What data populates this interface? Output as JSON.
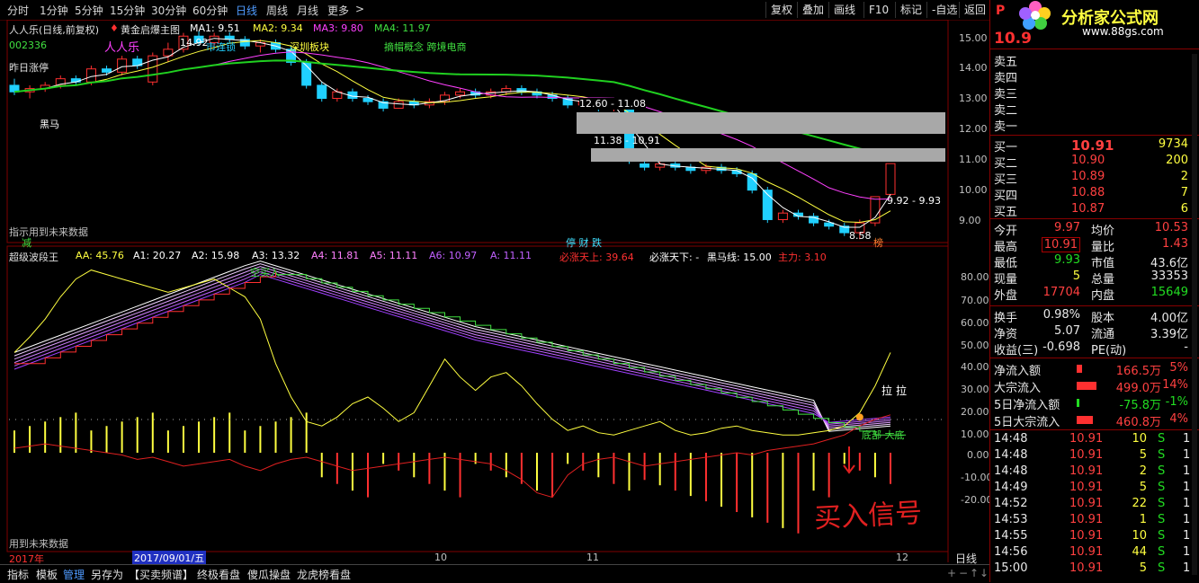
{
  "toolbar": {
    "periods": [
      "分时",
      "1分钟",
      "5分钟",
      "15分钟",
      "30分钟",
      "60分钟",
      "日线",
      "周线",
      "月线",
      "更多"
    ],
    "active_period": "日线",
    "more_arrow": ">",
    "buttons": [
      "复权",
      "叠加",
      "画线",
      "F10",
      "标记",
      "-自选",
      "返回"
    ]
  },
  "main_chart": {
    "title_stock": "人人乐(日线,前复权)",
    "title_indicator": "黄金启爆主图",
    "ma1": "MA1: 9.51",
    "ma2": "MA2: 9.34",
    "ma3": "MA3: 9.80",
    "ma4": "MA4: 11.97",
    "code": "002336",
    "name_overlay": "人人乐",
    "price_top_label": "14.92",
    "tag_lianbang": "市连锁",
    "tag_shenzhen": "深圳板块",
    "tag_concept": "摘帽概念 跨境电商",
    "yesterday_limit": "昨日涨停",
    "black_horse": "黑马",
    "range1": "12.60 - 11.08",
    "range2": "11.38 - 10.91",
    "range3": "9.92 - 9.93",
    "low_label": "8.58",
    "note_future": "指示用到未来数据",
    "tag_jian": "减",
    "tag_mid": "停 财 跌",
    "tag_bang": "榜",
    "price_axis": [
      "15.00",
      "14.00",
      "13.00",
      "12.00",
      "11.00",
      "10.00",
      "9.00"
    ],
    "colors": {
      "up": "#ff3030",
      "down": "#20d0ff",
      "ma1": "#ffffff",
      "ma2": "#ffff40",
      "ma3": "#ff40ff",
      "ma4": "#20d020"
    }
  },
  "sub_chart": {
    "name": "超级波段王",
    "aa": "AA: 45.76",
    "a1": "A1: 20.27",
    "a2": "A2: 15.98",
    "a3": "A3: 13.32",
    "a4": "A4: 11.81",
    "a5": "A5: 11.11",
    "a6": "A6: 10.97",
    "a": "A: 11.11",
    "bizhang_up": "必涨天上: 39.64",
    "bizhang_down": "必涨天下: -",
    "heima_line": "黑马线: 15.00",
    "zhuli": "主力: 3.10",
    "tag_buyin": "空买入",
    "tag_la1": "拉",
    "tag_la2": "拉",
    "tag_bottom": "底部 大底",
    "handwriting": "买入信号",
    "note_future": "用到未来数据",
    "axis": [
      "80.00",
      "70.00",
      "60.00",
      "50.00",
      "40.00",
      "30.00",
      "20.00",
      "10.00",
      "0.00",
      "-10.00",
      "-20.00"
    ]
  },
  "xaxis": {
    "year": "2017年",
    "cursor_date": "2017/09/01/五",
    "months": [
      "10",
      "11",
      "12"
    ],
    "period_btn": "日线"
  },
  "bottombar": [
    "指标",
    "模板",
    "管理",
    "另存为",
    "【买卖频谱】",
    "终极看盘",
    "傻瓜操盘",
    "龙虎榜看盘"
  ],
  "panel": {
    "brand_p": "P",
    "brand_name": "分析家公式网",
    "brand_url": "www.88gs.com",
    "price": "10.9",
    "sell": [
      {
        "label": "卖五",
        "price": "",
        "vol": ""
      },
      {
        "label": "卖四",
        "price": "",
        "vol": ""
      },
      {
        "label": "卖三",
        "price": "",
        "vol": ""
      },
      {
        "label": "卖二",
        "price": "",
        "vol": ""
      },
      {
        "label": "卖一",
        "price": "",
        "vol": ""
      }
    ],
    "buy": [
      {
        "label": "买一",
        "price": "10.91",
        "vol": "9734"
      },
      {
        "label": "买二",
        "price": "10.90",
        "vol": "200"
      },
      {
        "label": "买三",
        "price": "10.89",
        "vol": "2"
      },
      {
        "label": "买四",
        "price": "10.88",
        "vol": "7"
      },
      {
        "label": "买五",
        "price": "10.87",
        "vol": "6"
      }
    ],
    "stats": [
      {
        "l1": "今开",
        "v1": "9.97",
        "l2": "均价",
        "v2": "10.53"
      },
      {
        "l1": "最高",
        "v1": "10.91",
        "l2": "量比",
        "v2": "1.43"
      },
      {
        "l1": "最低",
        "v1": "9.93",
        "l2": "市值",
        "v2": "43.6亿"
      },
      {
        "l1": "现量",
        "v1": "5",
        "l2": "总量",
        "v2": "33353"
      },
      {
        "l1": "外盘",
        "v1": "17704",
        "l2": "内盘",
        "v2": "15649"
      }
    ],
    "finance": [
      {
        "l1": "换手",
        "v1": "0.98%",
        "l2": "股本",
        "v2": "4.00亿"
      },
      {
        "l1": "净资",
        "v1": "5.07",
        "l2": "流通",
        "v2": "3.39亿"
      },
      {
        "l1": "收益(三)",
        "v1": "-0.698",
        "l2": "PE(动)",
        "v2": "-"
      }
    ],
    "flows": [
      {
        "label": "净流入额",
        "value": "166.5万",
        "pct": "5%",
        "color": "red"
      },
      {
        "label": "大宗流入",
        "value": "499.0万",
        "pct": "14%",
        "color": "red"
      },
      {
        "label": "5日净流入额",
        "value": "-75.8万",
        "pct": "-1%",
        "color": "green"
      },
      {
        "label": "5日大宗流入",
        "value": "460.8万",
        "pct": "4%",
        "color": "red"
      }
    ],
    "ticks": [
      {
        "time": "14:48",
        "price": "10.91",
        "vol": "10",
        "side": "S",
        "n": "1"
      },
      {
        "time": "14:48",
        "price": "10.91",
        "vol": "5",
        "side": "S",
        "n": "1"
      },
      {
        "time": "14:48",
        "price": "10.91",
        "vol": "2",
        "side": "S",
        "n": "1"
      },
      {
        "time": "14:49",
        "price": "10.91",
        "vol": "5",
        "side": "S",
        "n": "1"
      },
      {
        "time": "14:52",
        "price": "10.91",
        "vol": "22",
        "side": "S",
        "n": "1"
      },
      {
        "time": "14:53",
        "price": "10.91",
        "vol": "1",
        "side": "S",
        "n": "1"
      },
      {
        "time": "14:55",
        "price": "10.91",
        "vol": "10",
        "side": "S",
        "n": "1"
      },
      {
        "time": "14:56",
        "price": "10.91",
        "vol": "44",
        "side": "S",
        "n": "1"
      },
      {
        "time": "15:00",
        "price": "10.91",
        "vol": "5",
        "side": "S",
        "n": "1"
      }
    ]
  },
  "chart_data": {
    "type": "candlestick",
    "candles": [
      [
        13.3,
        13.5,
        13.0,
        13.1
      ],
      [
        13.1,
        13.3,
        12.9,
        13.2
      ],
      [
        13.2,
        13.4,
        13.1,
        13.3
      ],
      [
        13.3,
        13.6,
        13.2,
        13.5
      ],
      [
        13.5,
        13.6,
        13.3,
        13.4
      ],
      [
        13.4,
        13.9,
        13.3,
        13.8
      ],
      [
        13.8,
        13.9,
        13.6,
        13.7
      ],
      [
        13.7,
        14.2,
        13.6,
        14.1
      ],
      [
        14.1,
        14.2,
        13.8,
        13.9
      ],
      [
        13.4,
        14.3,
        13.3,
        14.2
      ],
      [
        14.2,
        14.6,
        14.0,
        14.4
      ],
      [
        14.4,
        14.9,
        14.3,
        14.8
      ],
      [
        14.8,
        14.95,
        14.5,
        14.6
      ],
      [
        14.6,
        14.9,
        14.5,
        14.8
      ],
      [
        14.8,
        14.92,
        14.6,
        14.7
      ],
      [
        14.7,
        14.8,
        14.4,
        14.5
      ],
      [
        14.5,
        14.7,
        14.3,
        14.6
      ],
      [
        14.6,
        14.7,
        14.3,
        14.4
      ],
      [
        14.4,
        14.5,
        13.9,
        14.0
      ],
      [
        14.0,
        14.1,
        13.2,
        13.3
      ],
      [
        13.3,
        13.4,
        12.8,
        12.9
      ],
      [
        12.9,
        13.2,
        12.8,
        13.1
      ],
      [
        13.1,
        13.2,
        12.8,
        12.9
      ],
      [
        12.9,
        13.0,
        12.7,
        12.8
      ],
      [
        12.8,
        12.9,
        12.5,
        12.6
      ],
      [
        12.6,
        12.9,
        12.6,
        12.8
      ],
      [
        12.8,
        12.9,
        12.6,
        12.7
      ],
      [
        12.7,
        12.9,
        12.6,
        12.8
      ],
      [
        12.8,
        13.1,
        12.7,
        13.0
      ],
      [
        13.0,
        13.2,
        12.9,
        13.1
      ],
      [
        13.1,
        13.2,
        12.9,
        13.0
      ],
      [
        13.0,
        13.2,
        12.9,
        13.1
      ],
      [
        13.1,
        13.3,
        13.0,
        13.2
      ],
      [
        13.2,
        13.3,
        13.0,
        13.1
      ],
      [
        13.1,
        13.2,
        12.9,
        13.0
      ],
      [
        13.0,
        13.1,
        12.8,
        12.9
      ],
      [
        12.9,
        13.0,
        12.6,
        12.7
      ],
      [
        12.7,
        12.9,
        12.6,
        12.8
      ],
      [
        12.8,
        12.9,
        12.5,
        12.6
      ],
      [
        12.6,
        12.8,
        12.5,
        12.7
      ],
      [
        12.7,
        12.8,
        10.9,
        11.0
      ],
      [
        10.9,
        11.1,
        10.7,
        10.8
      ],
      [
        10.8,
        11.0,
        10.7,
        10.9
      ],
      [
        10.9,
        11.0,
        10.7,
        10.8
      ],
      [
        10.8,
        10.9,
        10.6,
        10.7
      ],
      [
        10.7,
        10.9,
        10.6,
        10.8
      ],
      [
        10.8,
        10.9,
        10.6,
        10.7
      ],
      [
        10.7,
        10.8,
        10.5,
        10.6
      ],
      [
        10.6,
        10.7,
        10.0,
        10.1
      ],
      [
        10.1,
        10.2,
        9.1,
        9.2
      ],
      [
        9.2,
        9.5,
        9.1,
        9.4
      ],
      [
        9.4,
        9.5,
        9.2,
        9.3
      ],
      [
        9.3,
        9.4,
        9.0,
        9.1
      ],
      [
        9.1,
        9.2,
        8.9,
        9.0
      ],
      [
        9.0,
        9.1,
        8.7,
        8.8
      ],
      [
        8.8,
        9.2,
        8.6,
        9.1
      ],
      [
        9.1,
        9.9,
        9.0,
        9.9
      ],
      [
        9.97,
        10.91,
        9.93,
        10.91
      ]
    ],
    "y_range": [
      8.5,
      15.3
    ]
  }
}
